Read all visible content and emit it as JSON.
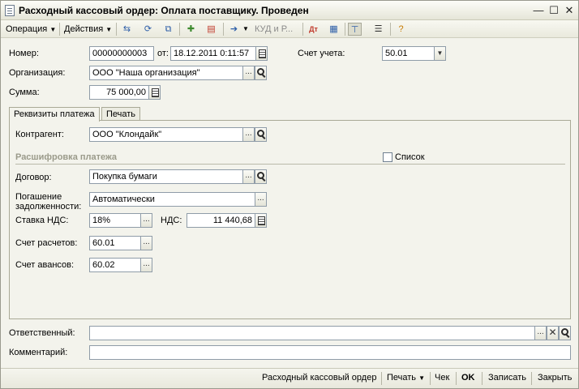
{
  "window": {
    "title": "Расходный кассовый ордер: Оплата поставщику. Проведен",
    "controls": {
      "minimize": "—",
      "maximize": "☐",
      "close": "✕"
    }
  },
  "toolbar": {
    "operation": "Операция",
    "actions": "Действия",
    "kudir": "КУД и Р...",
    "icons": [
      "move-icon",
      "refresh-icon",
      "copy-icon",
      "post-icon",
      "unpost-icon",
      "goto-icon",
      "dt-kt-icon",
      "report-icon",
      "structure-icon",
      "list-icon",
      "help-icon"
    ]
  },
  "header": {
    "number_label": "Номер:",
    "number_value": "00000000003",
    "date_label": "от:",
    "date_value": "18.12.2011  0:11:57",
    "account_label": "Счет учета:",
    "account_value": "50.01",
    "org_label": "Организация:",
    "org_value": "ООО \"Наша организация\"",
    "sum_label": "Сумма:",
    "sum_value": "75 000,00"
  },
  "tabs": [
    {
      "label": "Реквизиты платежа",
      "active": true
    },
    {
      "label": "Печать",
      "active": false
    }
  ],
  "payment": {
    "counterparty_label": "Контрагент:",
    "counterparty_value": "ООО \"Клондайк\"",
    "section_title": "Расшифровка платежа",
    "list_label": "Список",
    "contract_label": "Договор:",
    "contract_value": "Покупка бумаги",
    "debt_label_1": "Погашение",
    "debt_label_2": "задолженности:",
    "debt_value": "Автоматически",
    "vat_rate_label": "Ставка НДС:",
    "vat_rate_value": "18%",
    "vat_label": "НДС:",
    "vat_value": "11 440,68",
    "settlement_label": "Счет расчетов:",
    "settlement_value": "60.01",
    "advance_label": "Счет авансов:",
    "advance_value": "60.02"
  },
  "footer_fields": {
    "responsible_label": "Ответственный:",
    "responsible_value": "",
    "comment_label": "Комментарий:",
    "comment_value": ""
  },
  "statusbar": {
    "print_form": "Расходный кассовый ордер",
    "print": "Печать",
    "check": "Чек",
    "ok": "OK",
    "save": "Записать",
    "close": "Закрыть"
  }
}
